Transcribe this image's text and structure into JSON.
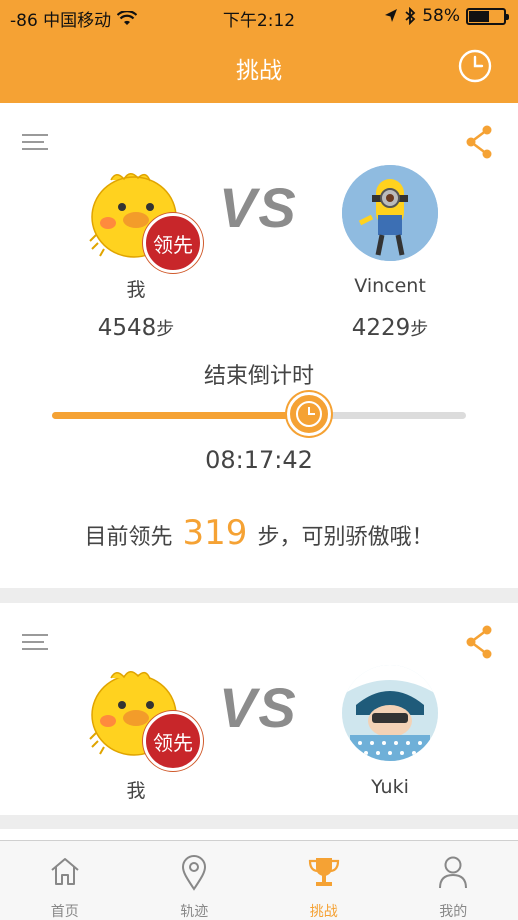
{
  "status_bar": {
    "carrier": "-86 中国移动",
    "time": "下午2:12",
    "battery": "58%",
    "battery_level": 0.58
  },
  "header": {
    "title": "挑战",
    "history_icon": "clock-icon"
  },
  "colors": {
    "accent": "#f5a234",
    "badge_red": "#c8262a",
    "vs_gray": "#8c8c8c"
  },
  "challenges": [
    {
      "me": {
        "name": "我",
        "steps": "4548",
        "unit": "步",
        "badge": "领先"
      },
      "vs": "VS",
      "opponent": {
        "name": "Vincent",
        "steps": "4229",
        "unit": "步"
      },
      "countdown_label": "结束倒计时",
      "progress": 0.62,
      "time_remaining": "08:17:42",
      "lead_prefix": "目前领先",
      "lead_steps": "319",
      "lead_suffix": "步，可别骄傲哦！"
    },
    {
      "me": {
        "name": "我",
        "badge": "领先"
      },
      "vs": "VS",
      "opponent": {
        "name": "Yuki"
      }
    }
  ],
  "tabs": [
    {
      "label": "首页",
      "icon": "home-icon",
      "active": false
    },
    {
      "label": "轨迹",
      "icon": "location-pin-icon",
      "active": false
    },
    {
      "label": "挑战",
      "icon": "trophy-icon",
      "active": true
    },
    {
      "label": "我的",
      "icon": "person-icon",
      "active": false
    }
  ]
}
